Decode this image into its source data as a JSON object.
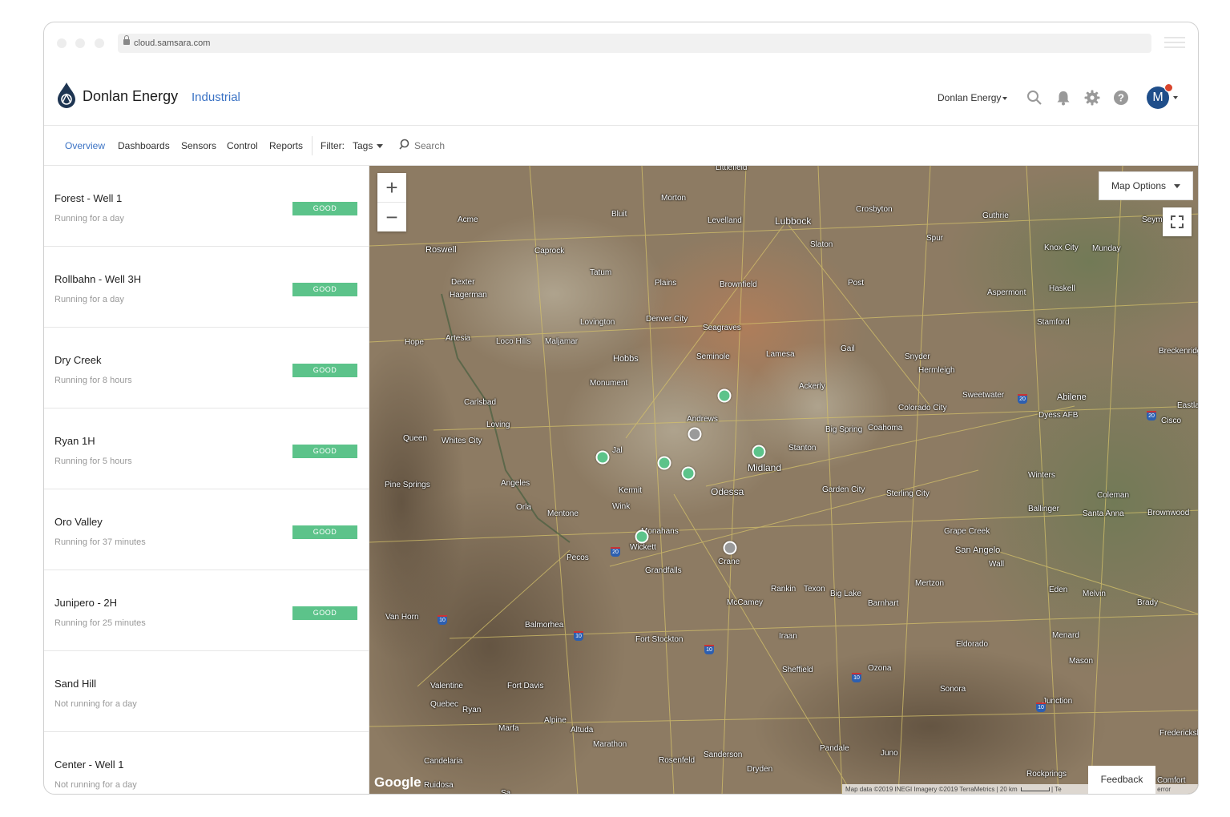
{
  "browser": {
    "url": "cloud.samsara.com"
  },
  "header": {
    "brand": "Donlan Energy",
    "section": "Industrial",
    "org_selector": "Donlan Energy",
    "avatar_initial": "M"
  },
  "nav": {
    "tabs": [
      "Overview",
      "Dashboards",
      "Sensors",
      "Control",
      "Reports"
    ],
    "filter_label": "Filter:",
    "filter_value": "Tags",
    "search_placeholder": "Search"
  },
  "assets": [
    {
      "name": "Forest - Well 1",
      "status": "Running for a day",
      "badge": "GOOD"
    },
    {
      "name": "Rollbahn - Well 3H",
      "status": "Running for a day",
      "badge": "GOOD"
    },
    {
      "name": "Dry Creek",
      "status": "Running for 8 hours",
      "badge": "GOOD"
    },
    {
      "name": "Ryan 1H",
      "status": "Running for 5 hours",
      "badge": "GOOD"
    },
    {
      "name": "Oro Valley",
      "status": "Running for 37 minutes",
      "badge": "GOOD"
    },
    {
      "name": "Junipero - 2H",
      "status": "Running for 25 minutes",
      "badge": "GOOD"
    },
    {
      "name": "Sand Hill",
      "status": "Not running for a day",
      "badge": ""
    },
    {
      "name": "Center - Well 1",
      "status": "Not running for a day",
      "badge": ""
    }
  ],
  "map": {
    "options_label": "Map Options",
    "zoom_in": "+",
    "zoom_out": "−",
    "feedback": "Feedback",
    "google": "Google",
    "attribution": "Map data ©2019 INEGI Imagery ©2019 TerraMetrics",
    "scale": "20 km",
    "terms_tail": "Te",
    "report_tail": "a map error",
    "colors": {
      "running": "#5cc38a",
      "stopped": "#9a9a9a"
    },
    "places": [
      "Littlefield",
      "Morton",
      "Bluit",
      "Levelland",
      "Lubbock",
      "Crosbyton",
      "Guthrie",
      "Seymour",
      "Acme",
      "Roswell",
      "Caprock",
      "Slaton",
      "Spur",
      "Knox City",
      "Munday",
      "Tatum",
      "Dexter",
      "Hagerman",
      "Plains",
      "Brownfield",
      "Post",
      "Aspermont",
      "Haskell",
      "Lovington",
      "Denver City",
      "Seagraves",
      "Stamford",
      "Artesia",
      "Hope",
      "Loco Hills",
      "Maljamar",
      "Hobbs",
      "Seminole",
      "Lamesa",
      "Gail",
      "Snyder",
      "Hermleigh",
      "Breckenridge",
      "Monument",
      "Ackerly",
      "Sweetwater",
      "Abilene",
      "Carlsbad",
      "Colorado City",
      "Dyess AFB",
      "Eastland",
      "Cisco",
      "Loving",
      "Andrews",
      "Big Spring",
      "Coahoma",
      "Queen",
      "Whites City",
      "Jal",
      "Stanton",
      "Midland",
      "Pine Springs",
      "Angeles",
      "Kermit",
      "Odessa",
      "Garden City",
      "Sterling City",
      "Winters",
      "Coleman",
      "Orla",
      "Mentone",
      "Wink",
      "Ballinger",
      "Santa Anna",
      "Brownwood",
      "Monahans",
      "Grape Creek",
      "Pecos",
      "Wickett",
      "San Angelo",
      "Wall",
      "Crane",
      "Grandfalls",
      "Rankin",
      "Texon",
      "Big Lake",
      "Mertzon",
      "Eden",
      "Melvin",
      "Brady",
      "McCamey",
      "Barnhart",
      "Van Horn",
      "Balmorhea",
      "Iraan",
      "Fort Stockton",
      "Eldorado",
      "Menard",
      "Mason",
      "Sheffield",
      "Ozona",
      "Valentine",
      "Fort Davis",
      "Sonora",
      "Junction",
      "Quebec",
      "Ryan",
      "Alpine",
      "Marfa",
      "Altuda",
      "Marathon",
      "Pandale",
      "Juno",
      "Fredericksburg",
      "Candelaria",
      "Rosenfeld",
      "Sanderson",
      "Dryden",
      "Rockprings",
      "Comfort",
      "Ruidosa",
      "Sa"
    ]
  }
}
